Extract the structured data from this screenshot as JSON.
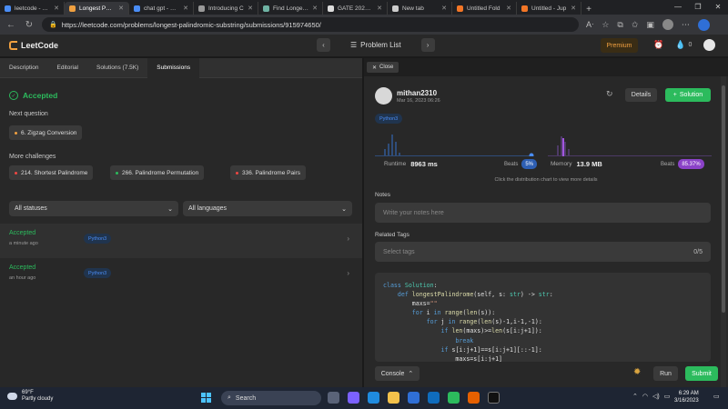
{
  "browser": {
    "tabs": [
      {
        "title": "leetcode - Sea",
        "color": "#4a8df6",
        "active": false
      },
      {
        "title": "Longest Palin",
        "color": "#f0a040",
        "active": true
      },
      {
        "title": "chat gpt - Sea",
        "color": "#4a8df6",
        "active": false
      },
      {
        "title": "Introducing C",
        "color": "#999999",
        "active": false
      },
      {
        "title": "Find Longest I",
        "color": "#6fb3a4",
        "active": false
      },
      {
        "title": "GATE 2023 Off",
        "color": "#dddddd",
        "active": false
      },
      {
        "title": "New tab",
        "color": "#cccccc",
        "active": false
      },
      {
        "title": "Untitled Fold",
        "color": "#f37626",
        "active": false
      },
      {
        "title": "Untitled - Jup",
        "color": "#f37626",
        "active": false
      }
    ],
    "url": "https://leetcode.com/problems/longest-palindromic-substring/submissions/915974650/"
  },
  "nav": {
    "logo": "LeetCode",
    "problem_list": "Problem List",
    "premium": "Premium",
    "points": "0"
  },
  "left": {
    "tabs": [
      "Description",
      "Editorial",
      "Solutions (7.5K)",
      "Submissions"
    ],
    "status": "Accepted",
    "next_question_label": "Next question",
    "next_question": "6. Zigzag Conversion",
    "more_challenges_label": "More challenges",
    "challenges": [
      {
        "title": "214. Shortest Palindrome",
        "color": "#ef4743"
      },
      {
        "title": "266. Palindrome Permutation",
        "color": "#2cbb5d"
      },
      {
        "title": "336. Palindrome Pairs",
        "color": "#ef4743"
      }
    ],
    "filter_status": "All statuses",
    "filter_language": "All languages",
    "submissions": [
      {
        "status": "Accepted",
        "time": "a minute ago",
        "lang": "Python3"
      },
      {
        "status": "Accepted",
        "time": "an hour ago",
        "lang": "Python3"
      }
    ]
  },
  "right": {
    "close": "Close",
    "username": "mithan2310",
    "date": "Mar 16, 2023 06:26",
    "details": "Details",
    "solution": "Solution",
    "language": "Python3",
    "runtime_label": "Runtime",
    "runtime": "8963 ms",
    "runtime_beats_label": "Beats",
    "runtime_beats": "5%",
    "memory_label": "Memory",
    "memory": "13.9 MB",
    "memory_beats_label": "Beats",
    "memory_beats": "85.37%",
    "hint": "Click the distribution chart to view more details",
    "notes_label": "Notes",
    "notes_placeholder": "Write your notes here",
    "tags_label": "Related Tags",
    "tags_placeholder": "Select tags",
    "tags_count": "0/5",
    "console": "Console",
    "run": "Run",
    "submit": "Submit"
  },
  "taskbar": {
    "temp": "69°F",
    "weather": "Partly cloudy",
    "search": "Search",
    "time": "6:29 AM",
    "date": "3/16/2023"
  }
}
